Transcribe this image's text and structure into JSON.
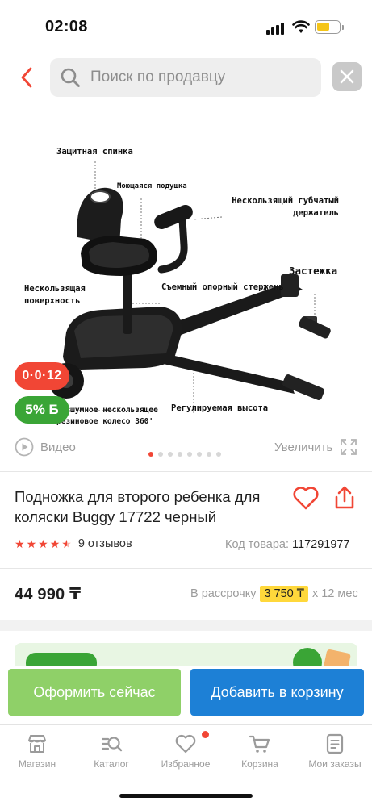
{
  "status_bar": {
    "time": "02:08"
  },
  "search": {
    "placeholder": "Поиск по продавцу"
  },
  "product_image": {
    "labels": {
      "backrest": "Защитная спинка",
      "cushion": "Моющаяся подушка",
      "handle": "Нескользящий губчатый держатель",
      "clasp": "Застежка",
      "platform": "Нескользящая поверхность",
      "rod": "Съемный опорный стержень",
      "wheel": "Бесшумное нескользящее резиновое колесо 360'",
      "height": "Регулируемая высота"
    },
    "badge_timer": "0·0·12",
    "badge_bonus": "5% Б",
    "video_label": "Видео",
    "zoom_label": "Увеличить",
    "dots_total": 8,
    "active_dot": 1
  },
  "product": {
    "title": "Подножка для второго ребенка для коляски Buggy 17722 черный",
    "rating": 4.5,
    "reviews": "9 отзывов",
    "code_label": "Код товара:",
    "code_value": "117291977",
    "price": "44 990 ₸",
    "installment_prefix": "В рассрочку",
    "installment_amount": "3 750 ₸",
    "installment_suffix": "х 12 мес"
  },
  "actions": {
    "order_label": "Оформить сейчас",
    "cart_label": "Добавить в корзину"
  },
  "tabs": [
    {
      "label": "Магазин",
      "icon": "shop-icon"
    },
    {
      "label": "Каталог",
      "icon": "catalog-icon"
    },
    {
      "label": "Избранное",
      "icon": "heart-icon",
      "notification": true
    },
    {
      "label": "Корзина",
      "icon": "cart-icon"
    },
    {
      "label": "Мои заказы",
      "icon": "orders-icon"
    }
  ],
  "colors": {
    "accent_red": "#f14635",
    "bonus_green": "#3aa536",
    "order_green": "#8fd068",
    "cart_blue": "#1d80d6",
    "installment_yellow": "#ffd83b"
  }
}
